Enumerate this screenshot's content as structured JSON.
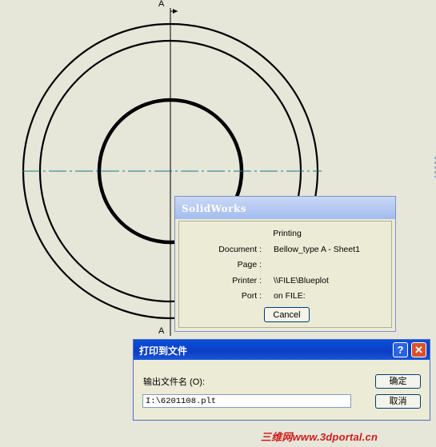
{
  "drawing": {
    "section_label_top": "A",
    "section_label_bottom": "A"
  },
  "sw_dialog": {
    "title": "SolidWorks",
    "heading": "Printing",
    "rows": [
      {
        "key": "Document :",
        "value": "Bellow_type A - Sheet1"
      },
      {
        "key": "Page :",
        "value": ""
      },
      {
        "key": "Printer :",
        "value": "\\\\FILE\\Blueplot"
      },
      {
        "key": "Port :",
        "value": "on FILE:"
      }
    ],
    "cancel_label": "Cancel"
  },
  "print_file_dialog": {
    "title": "打印到文件",
    "help_label": "?",
    "close_label": "✕",
    "filename_label": "输出文件名 (O):",
    "filename_value": "I:\\6201108.plt",
    "ok_label": "确定",
    "cancel_label": "取消"
  },
  "watermark": "三维网www.3dportal.cn"
}
